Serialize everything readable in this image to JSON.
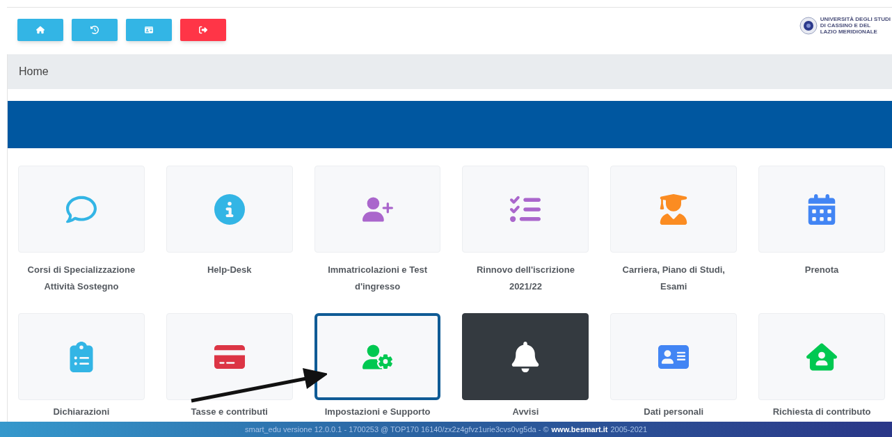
{
  "toolbar": [
    {
      "color": "#33b5e5"
    },
    {
      "color": "#33b5e5"
    },
    {
      "color": "#33b5e5"
    },
    {
      "color": "#ff3547"
    }
  ],
  "logo": {
    "lines": [
      "UNIVERSITÀ DEGLI STUDI",
      "DI CASSINO E DEL",
      "LAZIO MERIDIONALE"
    ]
  },
  "breadcrumb": "Home",
  "tiles": [
    {
      "label": "Corsi di Specializzazione Attività Sostegno",
      "kind": "tile",
      "selected": false,
      "color": "#33b5e5"
    },
    {
      "label": "Help-Desk",
      "kind": "tile",
      "selected": false,
      "color": "#33b5e5"
    },
    {
      "label": "Immatricolazioni e Test d'ingresso",
      "kind": "tile",
      "selected": false,
      "color": "#aa66cc"
    },
    {
      "label": "Rinnovo dell'iscrizione 2021/22",
      "kind": "tile",
      "selected": false,
      "color": "#aa66cc"
    },
    {
      "label": "Carriera, Piano di Studi, Esami",
      "kind": "tile",
      "selected": false,
      "color": "#fb8c22"
    },
    {
      "label": "Prenota",
      "kind": "tile",
      "selected": false,
      "color": "#4285f4"
    },
    {
      "label": "Dichiarazioni",
      "kind": "tile",
      "selected": false,
      "color": "#33b5e5"
    },
    {
      "label": "Tasse e contributi",
      "kind": "tile",
      "selected": false,
      "color": "#dc3545"
    },
    {
      "label": "Impostazioni e Supporto",
      "kind": "tile",
      "selected": true,
      "color": "#00c851"
    },
    {
      "label": "Avvisi",
      "kind": "dark",
      "selected": false,
      "color": "#ffffff"
    },
    {
      "label": "Dati personali",
      "kind": "tile",
      "selected": false,
      "color": "#4285f4"
    },
    {
      "label": "Richiesta di contributo",
      "kind": "tile",
      "selected": false,
      "color": "#00c851"
    }
  ],
  "footer": {
    "text": "smart_edu versione 12.0.0.1 - 1700253 @ TOP170 16140/zx2z4gfvz1urie3cvs0vg5da - ©",
    "link": "www.besmart.it",
    "years": "2005-2021"
  }
}
